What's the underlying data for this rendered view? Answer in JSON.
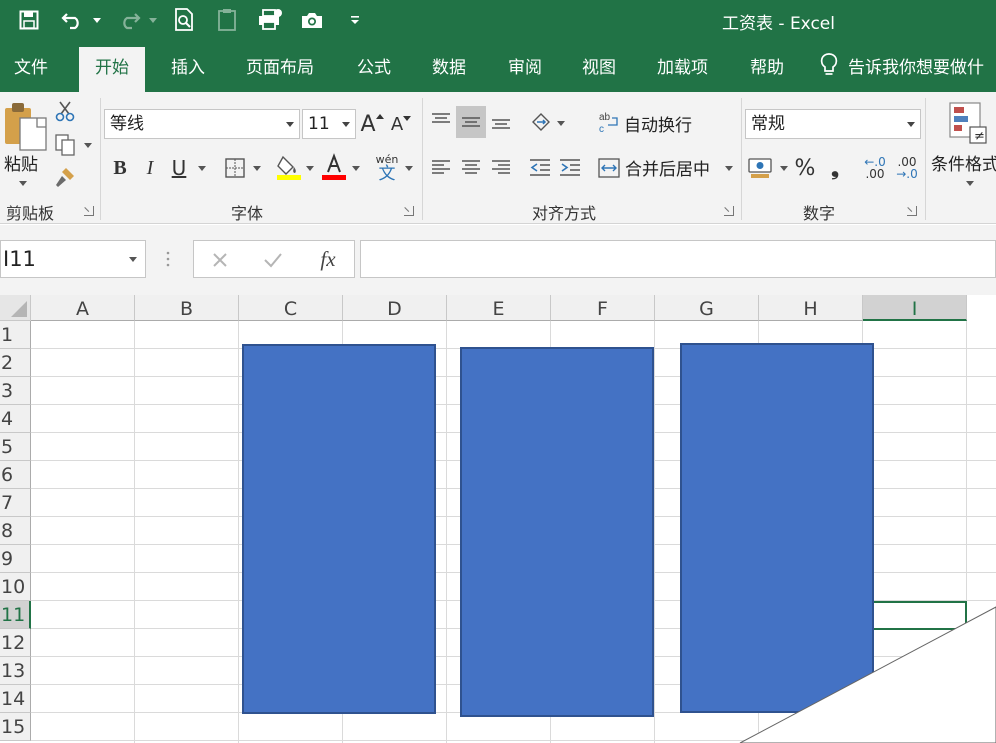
{
  "window": {
    "title": "工资表  -  Excel"
  },
  "tabs": [
    "文件",
    "开始",
    "插入",
    "页面布局",
    "公式",
    "数据",
    "审阅",
    "视图",
    "加载项",
    "帮助"
  ],
  "active_tab": "开始",
  "tell_me": "告诉我你想要做什",
  "clipboard": {
    "paste": "粘贴",
    "group": "剪贴板"
  },
  "font": {
    "name": "等线",
    "size": "11",
    "group": "字体",
    "bold": "B",
    "italic": "I",
    "underline": "U",
    "wen": "wén",
    "wen_char": "文",
    "increase": "A",
    "decrease": "A"
  },
  "alignment": {
    "wrap": "自动换行",
    "merge": "合并后居中",
    "group": "对齐方式"
  },
  "number": {
    "format": "常规",
    "percent": "%",
    "comma": "❟",
    "inc_dec_1": "←.0",
    "inc_dec_1b": ".00",
    "inc_dec_2": ".00",
    "inc_dec_2b": "→.0",
    "group": "数字"
  },
  "styles": {
    "conditional": "条件格式"
  },
  "formula_bar": {
    "name_box": "I11",
    "fx": "fx",
    "content": ""
  },
  "columns": [
    "A",
    "B",
    "C",
    "D",
    "E",
    "F",
    "G",
    "H",
    "I"
  ],
  "rows": [
    "1",
    "2",
    "3",
    "4",
    "5",
    "6",
    "7",
    "8",
    "9",
    "10",
    "11",
    "12",
    "13",
    "14",
    "15"
  ],
  "selected_cell": {
    "column": "I",
    "row": "11"
  },
  "shapes": [
    {
      "type": "rectangle",
      "fill": "#4472c4",
      "outline": "#2f528f"
    },
    {
      "type": "rectangle",
      "fill": "#4472c4",
      "outline": "#2f528f"
    },
    {
      "type": "rectangle",
      "fill": "#4472c4",
      "outline": "#2f528f"
    }
  ],
  "colors": {
    "accent": "#217346",
    "shape_fill": "#4472c4",
    "highlight": "#ffff00",
    "font_color": "#ff0000"
  }
}
